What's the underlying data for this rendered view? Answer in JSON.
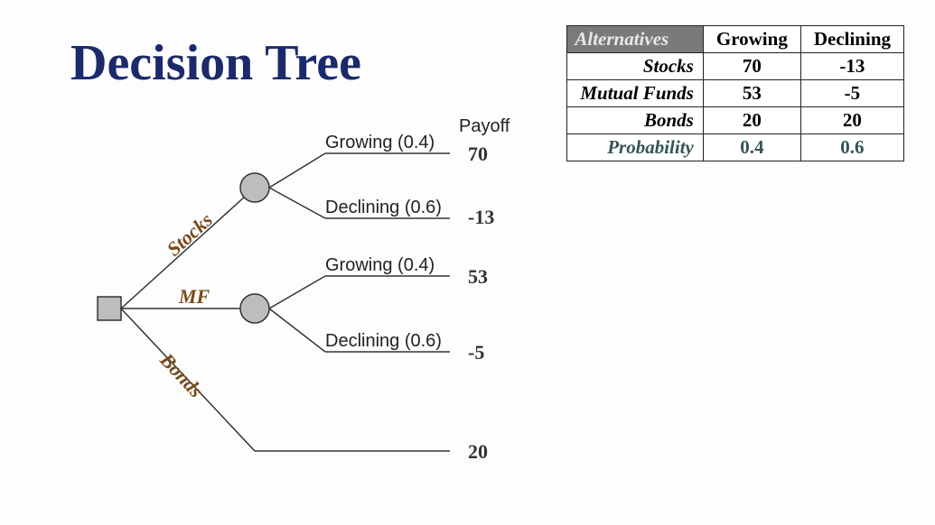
{
  "title": "Decision Tree",
  "payoff_header": "Payoff",
  "table": {
    "header_alt": "Alternatives",
    "header_grow": "Growing",
    "header_decl": "Declining",
    "rows": [
      {
        "name": "Stocks",
        "grow": "70",
        "decl": "-13"
      },
      {
        "name": "Mutual Funds",
        "grow": "53",
        "decl": "-5"
      },
      {
        "name": "Bonds",
        "grow": "20",
        "decl": "20"
      }
    ],
    "prob_label": "Probability",
    "prob_grow": "0.4",
    "prob_decl": "0.6"
  },
  "tree": {
    "branches": {
      "stocks": "Stocks",
      "mf": "MF",
      "bonds": "Bonds"
    },
    "states": {
      "grow": "Growing (0.4)",
      "decl": "Declining (0.6)"
    },
    "payoffs": {
      "stocks_grow": "70",
      "stocks_decl": "-13",
      "mf_grow": "53",
      "mf_decl": "-5",
      "bonds": "20"
    }
  }
}
